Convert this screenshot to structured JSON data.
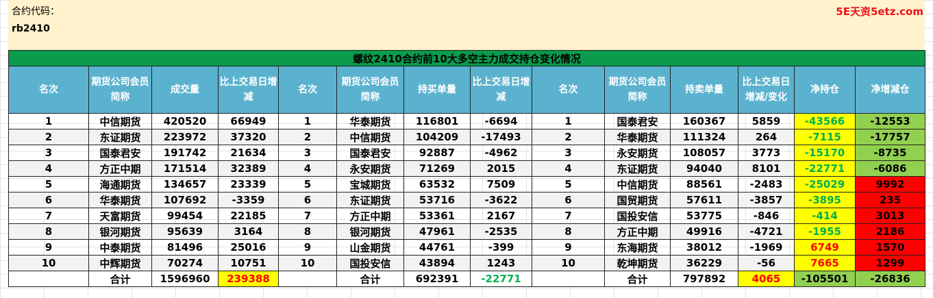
{
  "code_label": "合约代码：",
  "code_value": "rb2410",
  "watermark": "5E天资5etz.com",
  "table_title": "螺纹2410合约前10大多空主力成交持仓变化情况",
  "headers": [
    "名次",
    "期货公司会员简称",
    "成交量",
    "比上交易日增减",
    "名次",
    "期货公司会员简称",
    "持买单量",
    "比上交易日增减",
    "名次",
    "期货公司会员简称",
    "持卖单量",
    "比上交易日增减/变化",
    "净持仓",
    "净增减仓"
  ],
  "rows": [
    {
      "rank1": "1",
      "co1": "中信期货",
      "vol": "420520",
      "vol_chg": "66949",
      "rank2": "1",
      "co2": "华泰期货",
      "buy": "116801",
      "buy_chg": "-6694",
      "rank3": "1",
      "co3": "国泰君安",
      "sell": "160367",
      "sell_chg": "5859",
      "net": "-43566",
      "net_chg": "-12553"
    },
    {
      "rank1": "2",
      "co1": "东证期货",
      "vol": "223972",
      "vol_chg": "37320",
      "rank2": "2",
      "co2": "中信期货",
      "buy": "104209",
      "buy_chg": "-17493",
      "rank3": "2",
      "co3": "华泰期货",
      "sell": "111324",
      "sell_chg": "264",
      "net": "-7115",
      "net_chg": "-17757"
    },
    {
      "rank1": "3",
      "co1": "国泰君安",
      "vol": "191742",
      "vol_chg": "21634",
      "rank2": "3",
      "co2": "国泰君安",
      "buy": "92887",
      "buy_chg": "-4962",
      "rank3": "3",
      "co3": "永安期货",
      "sell": "108057",
      "sell_chg": "3773",
      "net": "-15170",
      "net_chg": "-8735"
    },
    {
      "rank1": "4",
      "co1": "方正中期",
      "vol": "171514",
      "vol_chg": "32389",
      "rank2": "4",
      "co2": "永安期货",
      "buy": "71269",
      "buy_chg": "2015",
      "rank3": "4",
      "co3": "东证期货",
      "sell": "94040",
      "sell_chg": "8101",
      "net": "-22771",
      "net_chg": "-6086"
    },
    {
      "rank1": "5",
      "co1": "海通期货",
      "vol": "134657",
      "vol_chg": "23339",
      "rank2": "5",
      "co2": "宝城期货",
      "buy": "63532",
      "buy_chg": "7509",
      "rank3": "5",
      "co3": "中信期货",
      "sell": "88561",
      "sell_chg": "-2483",
      "net": "-25029",
      "net_chg": "9992"
    },
    {
      "rank1": "6",
      "co1": "华泰期货",
      "vol": "107692",
      "vol_chg": "-3359",
      "rank2": "6",
      "co2": "东证期货",
      "buy": "53716",
      "buy_chg": "-3622",
      "rank3": "6",
      "co3": "国贸期货",
      "sell": "57611",
      "sell_chg": "-3857",
      "net": "-3895",
      "net_chg": "235"
    },
    {
      "rank1": "7",
      "co1": "天富期货",
      "vol": "99454",
      "vol_chg": "22185",
      "rank2": "7",
      "co2": "方正中期",
      "buy": "53361",
      "buy_chg": "2167",
      "rank3": "7",
      "co3": "国投安信",
      "sell": "53775",
      "sell_chg": "-846",
      "net": "-414",
      "net_chg": "3013"
    },
    {
      "rank1": "8",
      "co1": "银河期货",
      "vol": "95639",
      "vol_chg": "3164",
      "rank2": "8",
      "co2": "银河期货",
      "buy": "47961",
      "buy_chg": "-2535",
      "rank3": "8",
      "co3": "方正中期",
      "sell": "49916",
      "sell_chg": "-4721",
      "net": "-1955",
      "net_chg": "2186"
    },
    {
      "rank1": "9",
      "co1": "中泰期货",
      "vol": "81496",
      "vol_chg": "25016",
      "rank2": "9",
      "co2": "山金期货",
      "buy": "44761",
      "buy_chg": "-399",
      "rank3": "9",
      "co3": "东海期货",
      "sell": "38012",
      "sell_chg": "-1969",
      "net": "6749",
      "net_chg": "1570"
    },
    {
      "rank1": "10",
      "co1": "中辉期货",
      "vol": "70274",
      "vol_chg": "10751",
      "rank2": "10",
      "co2": "国投安信",
      "buy": "43894",
      "buy_chg": "1243",
      "rank3": "10",
      "co3": "乾坤期货",
      "sell": "36229",
      "sell_chg": "-56",
      "net": "7665",
      "net_chg": "1299"
    }
  ],
  "totals": {
    "label1": "合计",
    "vol": "1596960",
    "vol_chg": "239388",
    "label2": "合计",
    "buy": "692391",
    "buy_chg": "-22771",
    "label3": "合计",
    "sell": "797892",
    "sell_chg": "4065",
    "net": "-105501",
    "net_chg": "-26836"
  },
  "colors": {
    "title_bg": "#0a9b4d",
    "header_bg": "#5bb2cf",
    "code_bg": "#fff2cc",
    "positive_net_text": "#ff0000",
    "negative_net_text": "#00b050",
    "highlight_yellow": "#ffff00",
    "highlight_green": "#92d050",
    "highlight_red": "#ff0000"
  }
}
